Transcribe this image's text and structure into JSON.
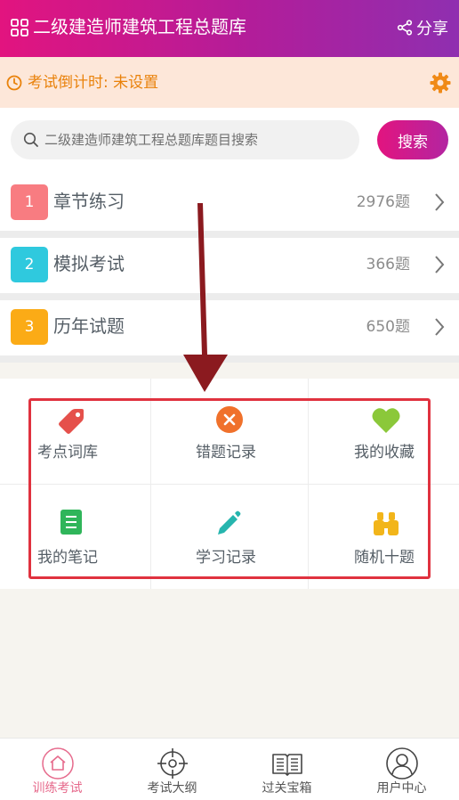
{
  "header": {
    "title": "二级建造师建筑工程总题库",
    "share_label": "分享"
  },
  "countdown": {
    "text": "考试倒计时: 未设置"
  },
  "search": {
    "placeholder": "二级建造师建筑工程总题库题目搜索",
    "button_label": "搜索"
  },
  "practice_list": [
    {
      "number": "1",
      "label": "章节练习",
      "count": "2976题",
      "color": "#f87c81"
    },
    {
      "number": "2",
      "label": "模拟考试",
      "count": "366题",
      "color": "#2fc9de"
    },
    {
      "number": "3",
      "label": "历年试题",
      "count": "650题",
      "color": "#fbab16"
    }
  ],
  "tools": [
    {
      "label": "考点词库",
      "icon": "tag-icon",
      "color": "#e5504b"
    },
    {
      "label": "错题记录",
      "icon": "x-circle-icon",
      "color": "#f0712b"
    },
    {
      "label": "我的收藏",
      "icon": "heart-icon",
      "color": "#8bc83a"
    },
    {
      "label": "我的笔记",
      "icon": "notebook-icon",
      "color": "#2fb55a"
    },
    {
      "label": "学习记录",
      "icon": "pencil-icon",
      "color": "#26b5ae"
    },
    {
      "label": "随机十题",
      "icon": "binoculars-icon",
      "color": "#f2b51a"
    }
  ],
  "bottom_nav": [
    {
      "label": "训练考试",
      "icon": "home-icon",
      "active": true
    },
    {
      "label": "考试大纲",
      "icon": "crosshair-icon",
      "active": false
    },
    {
      "label": "过关宝箱",
      "icon": "book-icon",
      "active": false
    },
    {
      "label": "用户中心",
      "icon": "user-icon",
      "active": false
    }
  ],
  "colors": {
    "brand_start": "#e2147f",
    "brand_end": "#8f2fb0",
    "highlight": "#e0323f",
    "arrow": "#8b1a1f"
  }
}
